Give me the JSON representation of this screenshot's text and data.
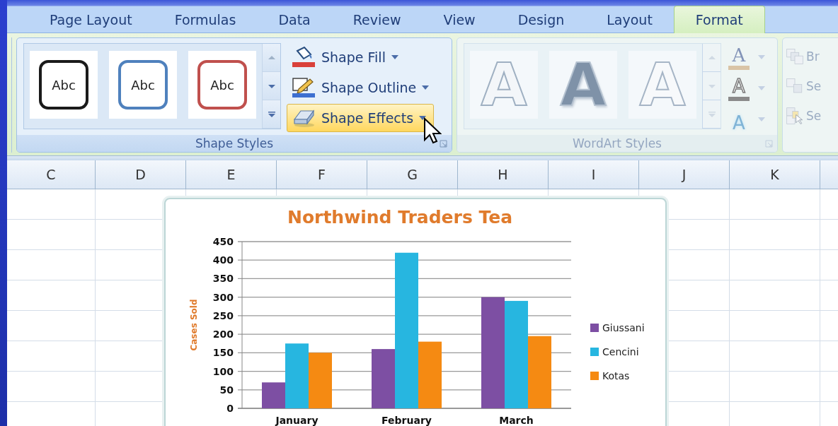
{
  "tabs": [
    {
      "label": "Page Layout",
      "selected": false
    },
    {
      "label": "Formulas",
      "selected": false
    },
    {
      "label": "Data",
      "selected": false
    },
    {
      "label": "Review",
      "selected": false
    },
    {
      "label": "View",
      "selected": false
    },
    {
      "label": "Design",
      "selected": false
    },
    {
      "label": "Layout",
      "selected": false
    },
    {
      "label": "Format",
      "selected": true
    }
  ],
  "shape_styles": {
    "label": "Shape Styles",
    "gallery": [
      {
        "text": "Abc",
        "color": "#1a1a1a"
      },
      {
        "text": "Abc",
        "color": "#4f81bd"
      },
      {
        "text": "Abc",
        "color": "#c0504d"
      }
    ],
    "commands": [
      {
        "kind": "fill",
        "label": "Shape Fill",
        "hovered": false
      },
      {
        "kind": "outline",
        "label": "Shape Outline",
        "hovered": false
      },
      {
        "kind": "effects",
        "label": "Shape Effects",
        "hovered": true
      }
    ]
  },
  "wordart_styles": {
    "label": "WordArt Styles",
    "disabled": true,
    "gallery": [
      {
        "kind": "plain",
        "glyph": "A"
      },
      {
        "kind": "shadow",
        "glyph": "A"
      },
      {
        "kind": "light",
        "glyph": "A"
      }
    ],
    "tools": [
      {
        "kind": "fill",
        "glyph": "A"
      },
      {
        "kind": "outline",
        "glyph": "A"
      },
      {
        "kind": "effects",
        "glyph": "A"
      }
    ]
  },
  "arrange": {
    "disabled": true,
    "items": [
      {
        "kind": "front",
        "label": "Br"
      },
      {
        "kind": "back",
        "label": "Se"
      },
      {
        "kind": "select",
        "label": "Se"
      }
    ]
  },
  "columns": [
    "C",
    "D",
    "E",
    "F",
    "G",
    "H",
    "I",
    "J",
    "K"
  ],
  "chart": {
    "chart_data": {
      "type": "bar",
      "title": "Northwind Traders Tea",
      "ylabel": "Cases Sold",
      "categories": [
        "January",
        "February",
        "March"
      ],
      "series": [
        {
          "name": "Giussani",
          "color": "#7d4fa3",
          "values": [
            70,
            160,
            300
          ]
        },
        {
          "name": "Cencini",
          "color": "#27b6e0",
          "values": [
            175,
            420,
            290
          ]
        },
        {
          "name": "Kotas",
          "color": "#f58a12",
          "values": [
            150,
            180,
            195
          ]
        }
      ],
      "grid": true,
      "legend": "right",
      "ylim": [
        0,
        450
      ],
      "yticks": [
        0,
        50,
        100,
        150,
        200,
        250,
        300,
        350,
        400,
        450
      ]
    }
  }
}
